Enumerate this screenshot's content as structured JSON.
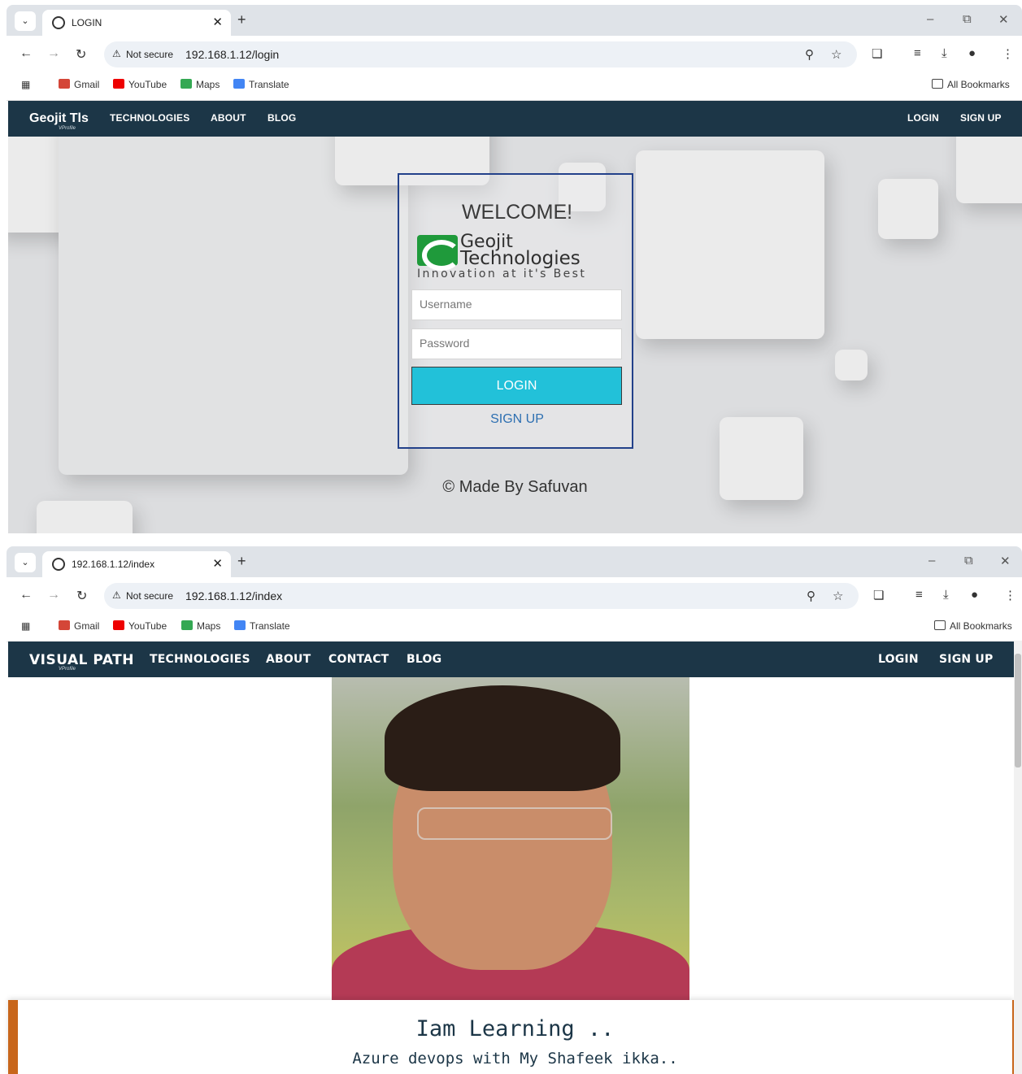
{
  "login_window": {
    "tab_title": "LOGIN",
    "not_secure": "Not secure",
    "url": "192.168.1.12/login",
    "bookmarks": [
      "Gmail",
      "YouTube",
      "Maps",
      "Translate"
    ],
    "all_bookmarks": "All Bookmarks",
    "brand": "Geojit Tls",
    "brand_sub": "VProfile",
    "nav": [
      "TECHNOLOGIES",
      "ABOUT",
      "BLOG"
    ],
    "nav_right": [
      "LOGIN",
      "SIGN UP"
    ],
    "welcome": "WELCOME!",
    "logo_line1": "Geojit",
    "logo_line2": "Technologies",
    "logo_tagline": "Innovation at it's Best",
    "username_placeholder": "Username",
    "password_placeholder": "Password",
    "login_button": "LOGIN",
    "signup_link": "SIGN UP",
    "credit": "© Made By Safuvan"
  },
  "index_window": {
    "tab_title": "192.168.1.12/index",
    "not_secure": "Not secure",
    "url": "192.168.1.12/index",
    "bookmarks": [
      "Gmail",
      "YouTube",
      "Maps",
      "Translate"
    ],
    "all_bookmarks": "All Bookmarks",
    "brand": "VISUAL PATH",
    "brand_sub": "VProfile",
    "nav": [
      "TECHNOLOGIES",
      "ABOUT",
      "CONTACT",
      "BLOG"
    ],
    "nav_right": [
      "LOGIN",
      "SIGN UP"
    ],
    "card_title": "Iam Learning ..",
    "card_subtitle": "Azure devops with My Shafeek ikka.."
  },
  "colors": {
    "nav_bg": "#1c3647",
    "login_button": "#22c1d9",
    "box_border": "#23418a",
    "card_accent": "#c8661b",
    "link": "#2d6fb1"
  }
}
